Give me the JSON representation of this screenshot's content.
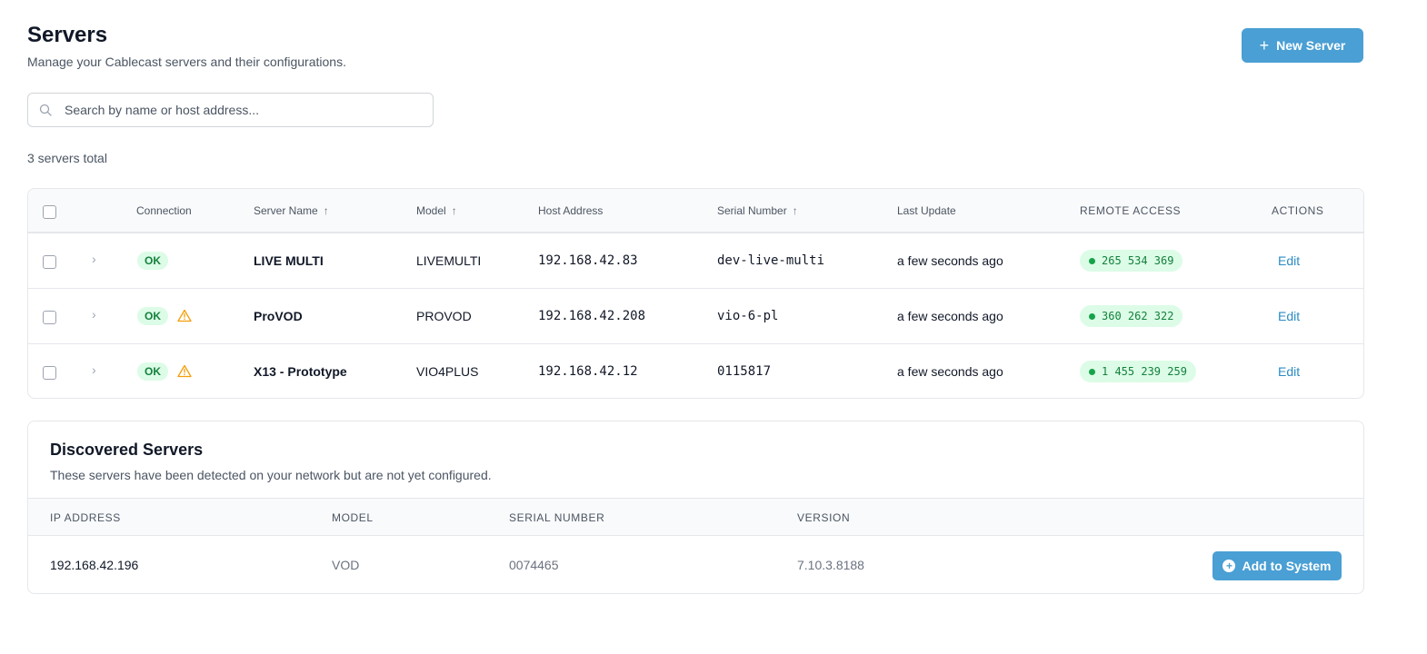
{
  "header": {
    "title": "Servers",
    "subtitle": "Manage your Cablecast servers and their configurations.",
    "new_button_label": "New Server"
  },
  "search": {
    "placeholder": "Search by name or host address...",
    "value": ""
  },
  "summary": {
    "total_text": "3 servers total"
  },
  "table": {
    "columns": {
      "connection": "Connection",
      "server_name": "Server Name",
      "model": "Model",
      "host_address": "Host Address",
      "serial_number": "Serial Number",
      "last_update": "Last Update",
      "remote_access": "REMOTE ACCESS",
      "actions": "ACTIONS"
    },
    "sort_indicator": "↑",
    "rows": [
      {
        "connection": "OK",
        "warning": false,
        "name": "LIVE MULTI",
        "model": "LIVEMULTI",
        "host": "192.168.42.83",
        "serial": "dev-live-multi",
        "last_update": "a few seconds ago",
        "remote_access": "265 534 369",
        "action": "Edit"
      },
      {
        "connection": "OK",
        "warning": true,
        "name": "ProVOD",
        "model": "PROVOD",
        "host": "192.168.42.208",
        "serial": "vio-6-pl",
        "last_update": "a few seconds ago",
        "remote_access": "360 262 322",
        "action": "Edit"
      },
      {
        "connection": "OK",
        "warning": true,
        "name": "X13 - Prototype",
        "model": "VIO4PLUS",
        "host": "192.168.42.12",
        "serial": "0115817",
        "last_update": "a few seconds ago",
        "remote_access": "1 455 239 259",
        "action": "Edit"
      }
    ]
  },
  "discovered": {
    "title": "Discovered Servers",
    "subtitle": "These servers have been detected on your network but are not yet configured.",
    "columns": {
      "ip": "IP ADDRESS",
      "model": "MODEL",
      "serial": "SERIAL NUMBER",
      "version": "VERSION"
    },
    "rows": [
      {
        "ip": "192.168.42.196",
        "model": "VOD",
        "serial": "0074465",
        "version": "7.10.3.8188",
        "action": "Add to System"
      }
    ]
  },
  "colors": {
    "primary": "#4a9fd4",
    "link": "#2b8cc4",
    "success_bg": "#dcfce7",
    "success_text": "#15803d",
    "warning": "#f59e0b"
  },
  "icons": {
    "search": "search-icon",
    "plus": "plus-icon",
    "chevron": "chevron-right-icon",
    "warning": "warning-triangle-icon",
    "status_dot": "status-dot-icon",
    "plus_circle": "plus-circle-icon"
  }
}
